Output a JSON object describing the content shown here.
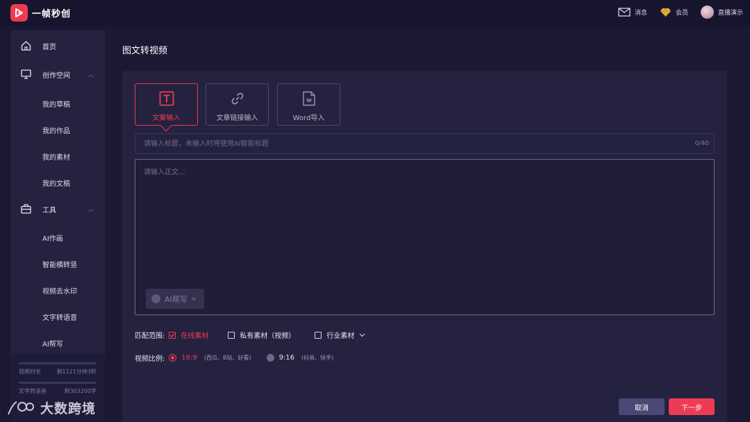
{
  "app": {
    "name": "一帧秒创"
  },
  "topbar": {
    "messages": "消息",
    "member": "会员",
    "user": "直播演示"
  },
  "sidebar": {
    "home": "首页",
    "workspace": {
      "label": "创作空间",
      "items": [
        "我的草稿",
        "我的作品",
        "我的素材",
        "我的文稿"
      ]
    },
    "tools": {
      "label": "工具",
      "items": [
        "AI作画",
        "智能横转竖",
        "视频去水印",
        "文字转语音",
        "AI帮写"
      ]
    },
    "quota": [
      {
        "label": "视频时长",
        "value": "剩1121分钟3秒"
      },
      {
        "label": "文字转语音",
        "value": "剩303200字"
      }
    ]
  },
  "main": {
    "title": "图文转视频",
    "tabs": [
      {
        "label": "文案输入",
        "icon": "text-icon",
        "active": true
      },
      {
        "label": "文章链接输入",
        "icon": "link-icon",
        "active": false
      },
      {
        "label": "Word导入",
        "icon": "word-file-icon",
        "active": false
      }
    ],
    "title_input": {
      "placeholder": "请输入标题，未输入时将使用AI智能标题",
      "value": "",
      "counter": "0/40"
    },
    "body_input": {
      "placeholder": "请输入正文…",
      "value": ""
    },
    "ai_write": {
      "label": "AI帮写",
      "suffix": "»"
    },
    "match_scope": {
      "label": "匹配范围:",
      "options": [
        {
          "label": "在线素材",
          "checked": true
        },
        {
          "label": "私有素材（视频）",
          "checked": false
        },
        {
          "label": "行业素材",
          "checked": false
        }
      ]
    },
    "ratio": {
      "label": "视频比例:",
      "options": [
        {
          "label": "16:9",
          "note": "(西瓜、B站、好看)",
          "selected": true
        },
        {
          "label": "9:16",
          "note": "(抖音、快手)",
          "selected": false
        }
      ]
    },
    "cancel": "取消",
    "next": "下一步"
  },
  "watermark": "大数跨境",
  "colors": {
    "accent": "#ee3b54",
    "background": "#1a1833",
    "panel": "#24223f"
  }
}
